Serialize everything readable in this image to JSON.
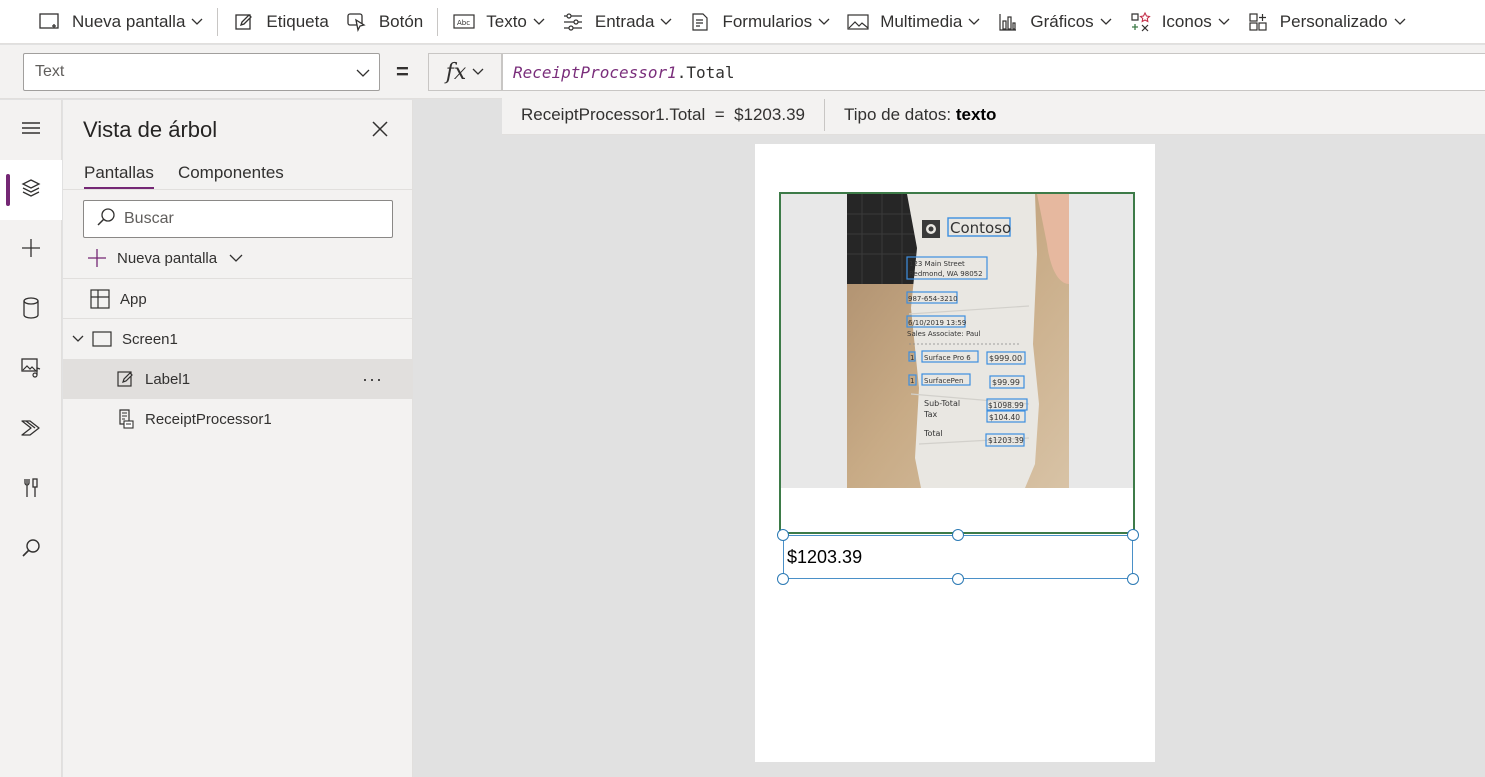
{
  "ribbon": {
    "items": [
      {
        "label": "Nueva pantalla",
        "icon": "new-screen-icon",
        "dropdown": true
      },
      {
        "label": "Etiqueta",
        "icon": "label-edit-icon",
        "dropdown": false
      },
      {
        "label": "Botón",
        "icon": "button-cursor-icon",
        "dropdown": false
      },
      {
        "label": "Texto",
        "icon": "text-abc-icon",
        "dropdown": true
      },
      {
        "label": "Entrada",
        "icon": "input-sliders-icon",
        "dropdown": true
      },
      {
        "label": "Formularios",
        "icon": "forms-icon",
        "dropdown": true
      },
      {
        "label": "Multimedia",
        "icon": "media-image-icon",
        "dropdown": true
      },
      {
        "label": "Gráficos",
        "icon": "charts-icon",
        "dropdown": true
      },
      {
        "label": "Iconos",
        "icon": "icons-icon",
        "dropdown": true
      },
      {
        "label": "Personalizado",
        "icon": "custom-icon",
        "dropdown": true
      }
    ]
  },
  "formula_bar": {
    "property": "Text",
    "fx_label": "fx",
    "formula_control": "ReceiptProcessor1",
    "formula_rest": ".Total",
    "result_expr": "ReceiptProcessor1.Total  =  $1203.39",
    "data_type_label": "Tipo de datos:",
    "data_type_value": "texto"
  },
  "rail": {
    "items": [
      "menu-icon",
      "tree-view-icon",
      "insert-plus-icon",
      "data-icon",
      "media-icon",
      "power-automate-icon",
      "advanced-tools-icon",
      "search-icon"
    ],
    "active_index": 1,
    "accent": "#742774"
  },
  "tree_view": {
    "title": "Vista de árbol",
    "tabs": [
      "Pantallas",
      "Componentes"
    ],
    "active_tab": 0,
    "search_placeholder": "Buscar",
    "new_screen_label": "Nueva pantalla",
    "nodes": [
      {
        "label": "App",
        "icon": "app-grid-icon"
      },
      {
        "label": "Screen1",
        "icon": "screen-icon",
        "expanded": true
      },
      {
        "label": "Label1",
        "icon": "label-edit-icon",
        "selected": true
      },
      {
        "label": "ReceiptProcessor1",
        "icon": "receipt-processor-icon"
      }
    ],
    "more_label": "···"
  },
  "canvas": {
    "label_text": "$1203.39",
    "selection_color": "#2b79b4",
    "component_border_color": "#3d7b48"
  },
  "receipt": {
    "brand": "Contoso",
    "address1": "123 Main Street",
    "address2": "Redmond, WA 98052",
    "phone": "987-654-3210",
    "datetime": "6/10/2019 13:59",
    "associate": "Sales Associate: Paul",
    "line1_qty": "1",
    "line1_item": "Surface Pro 6",
    "line1_price": "$999.00",
    "line2_qty": "1",
    "line2_item": "SurfacePen",
    "line2_price": "$99.99",
    "subtotal_label": "Sub-Total",
    "subtotal": "$1098.99",
    "tax_label": "Tax",
    "tax": "$104.40",
    "total_label": "Total",
    "total": "$1203.39"
  }
}
